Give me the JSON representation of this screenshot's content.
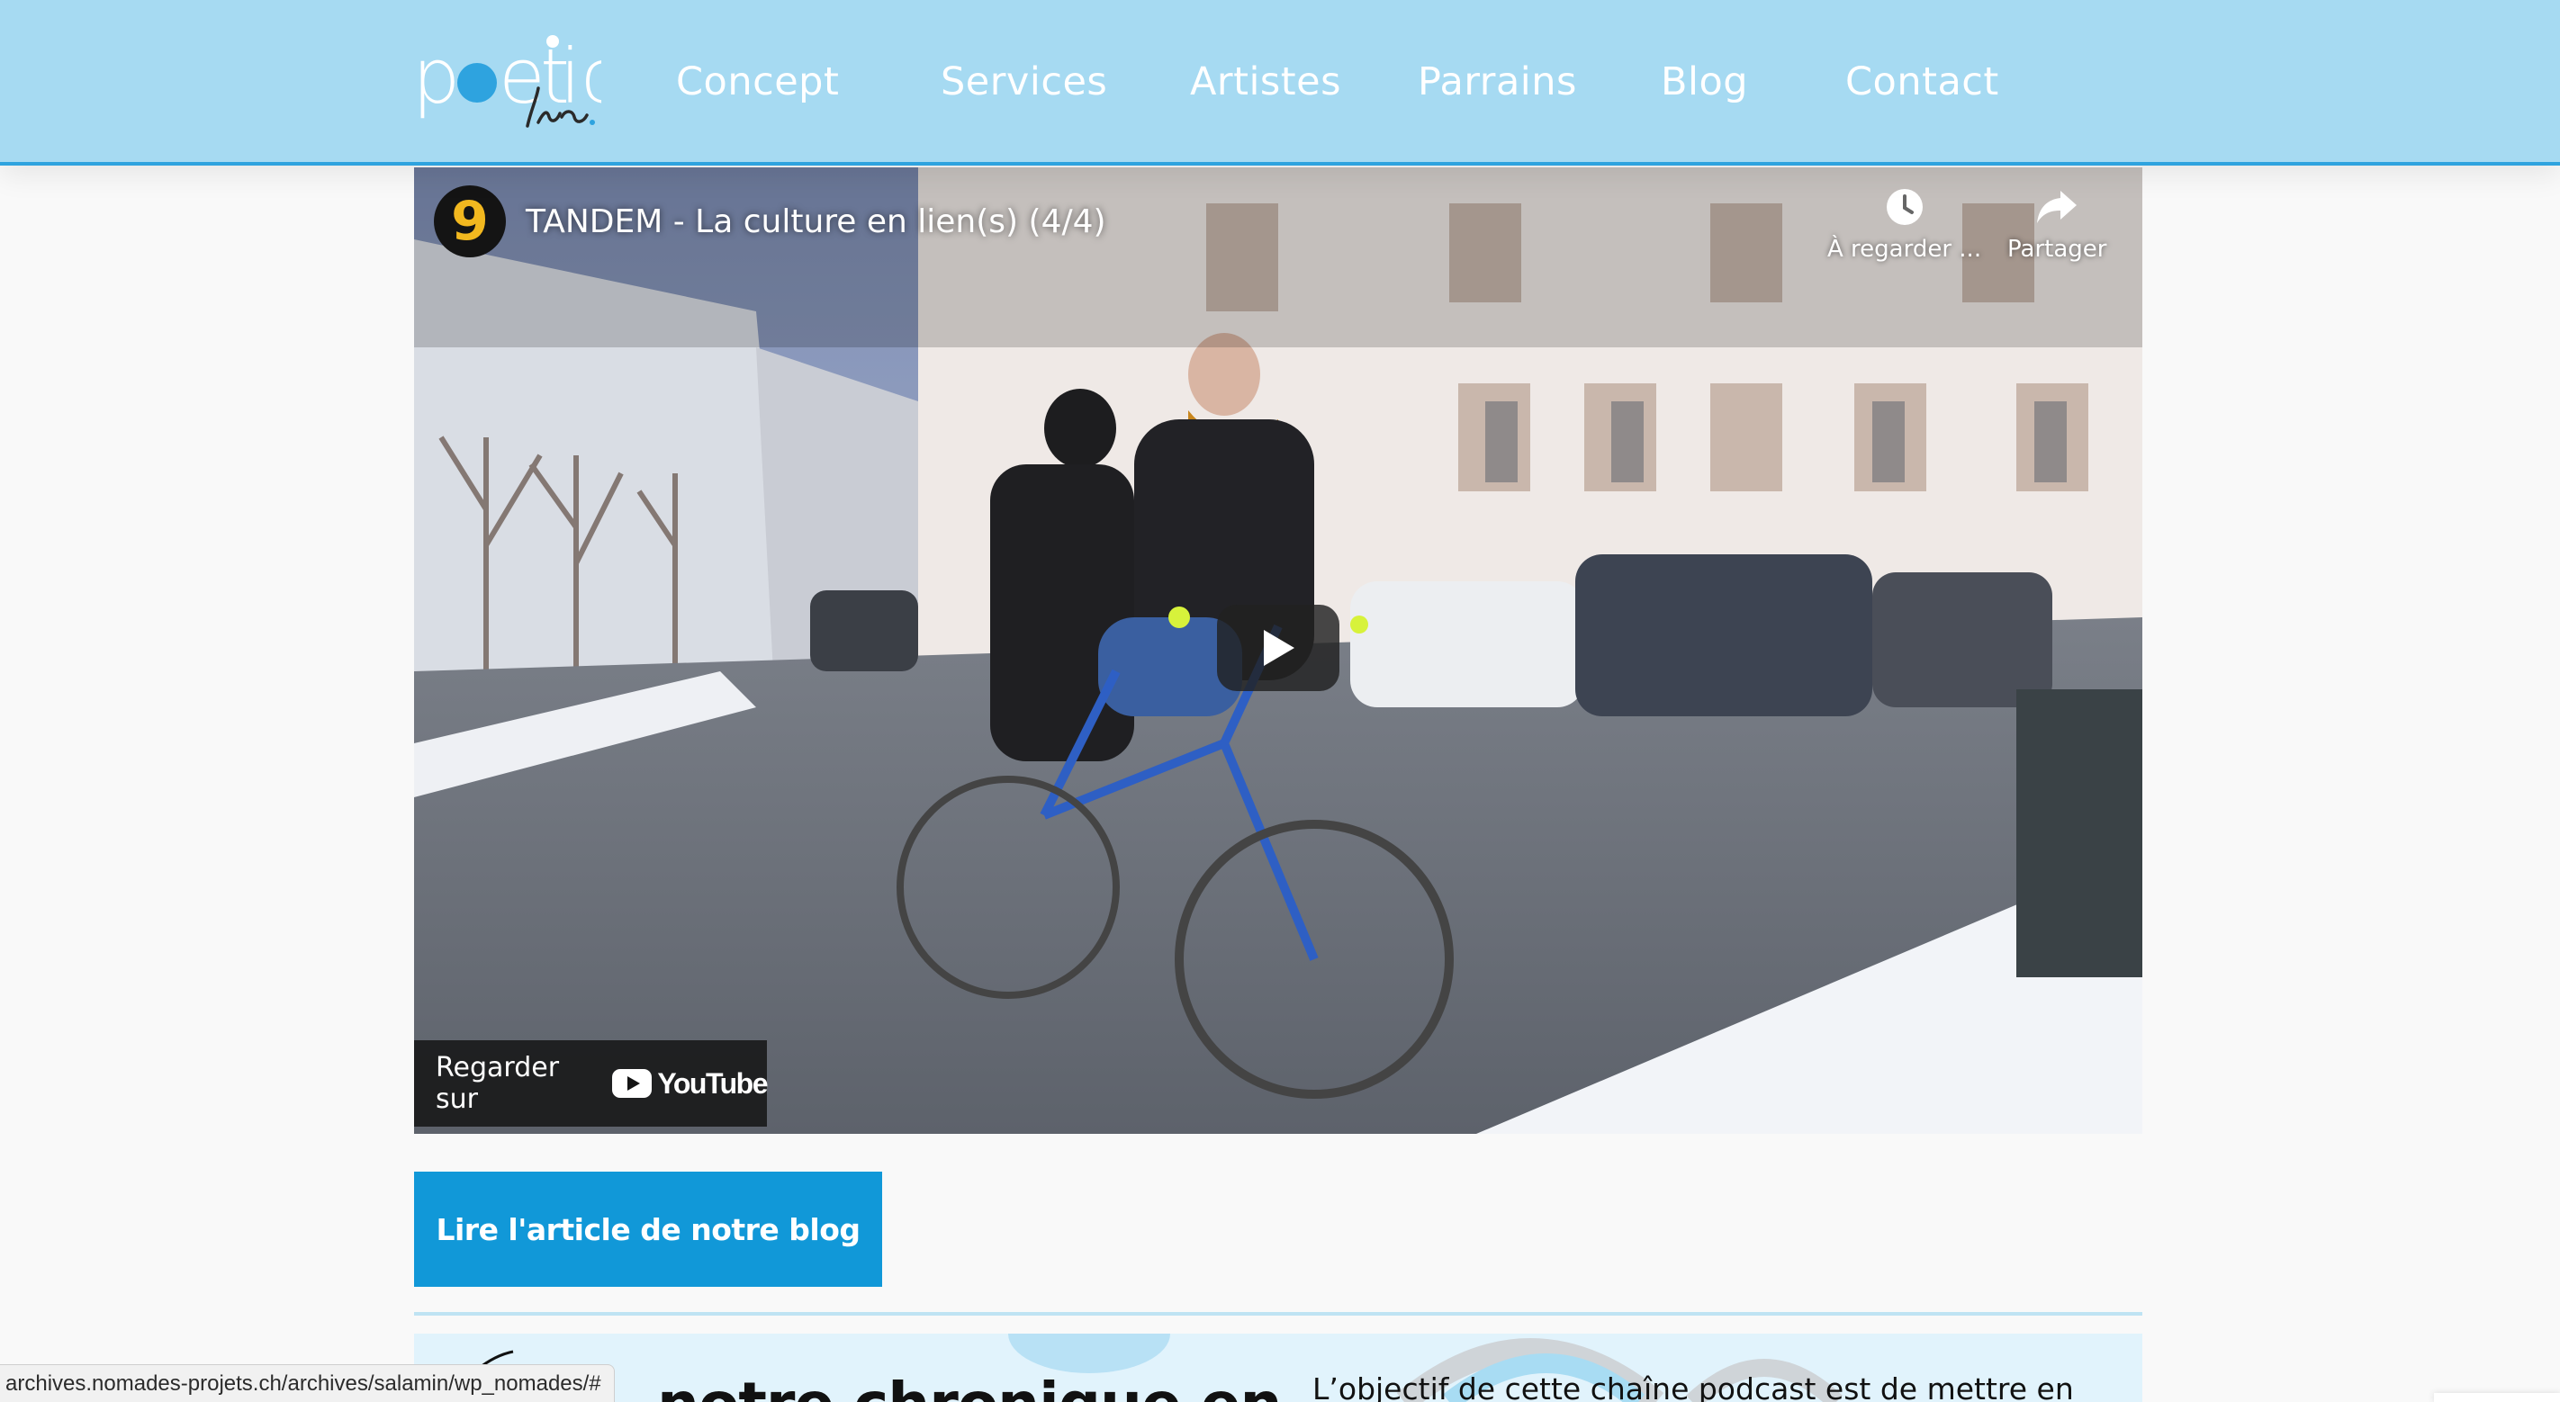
{
  "logo": {
    "word": "poetic",
    "script": "luc"
  },
  "nav": {
    "items": [
      {
        "label": "Concept"
      },
      {
        "label": "Services"
      },
      {
        "label": "Artistes"
      },
      {
        "label": "Parrains"
      },
      {
        "label": "Blog"
      },
      {
        "label": "Contact"
      }
    ]
  },
  "video": {
    "channel_badge": "9",
    "title": "TANDEM - La culture en lien(s) (4/4)",
    "watch_later_label": "À regarder ...",
    "share_label": "Partager",
    "watch_on_label": "Regarder sur",
    "youtube_wordmark": "YouTube"
  },
  "cta": {
    "label": "Lire l'article de notre blog"
  },
  "chronicle": {
    "heading": "notre chronique en",
    "text": "L’objectif de cette chaîne podcast est de mettre en"
  },
  "status_bar": {
    "url": "archives.nomades-projets.ch/archives/salamin/wp_nomades/#"
  },
  "colors": {
    "header_bg": "#a6daf2",
    "header_border": "#2ea3df",
    "cta_bg": "#1198d8",
    "badge_yellow": "#f2b81f",
    "youtube_red": "#ff0000"
  },
  "icons": [
    "clock-icon",
    "share-icon",
    "play-icon",
    "youtube-play-icon"
  ]
}
